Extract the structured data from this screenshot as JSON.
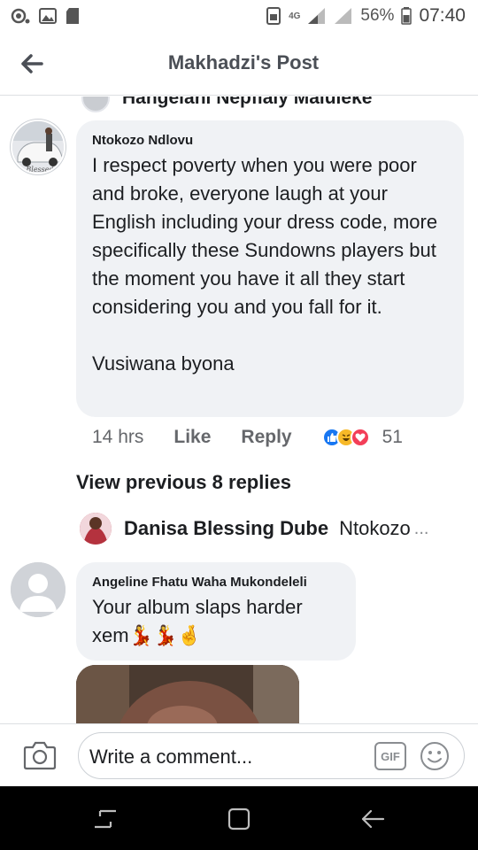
{
  "status_bar": {
    "battery_percent": "56%",
    "time": "07:40",
    "network": "4G",
    "icons": [
      "notification-icon",
      "gallery-icon",
      "sd-card-icon",
      "nfc-icon",
      "signal-icon",
      "battery-icon"
    ]
  },
  "header": {
    "title": "Makhadzi's Post",
    "back_icon": "arrow-left-icon"
  },
  "clipped_previous": {
    "text": "Hangelani Nepfialy Maluleke"
  },
  "comment": {
    "author": "Ntokozo Ndlovu",
    "body": "I respect poverty when you were poor and broke, everyone laugh at your English including your dress code, more specifically these Sundowns players but the moment you have it all they start considering you and you fall for it.",
    "body_2": "Vusiwana byona",
    "time": "14 hrs",
    "like_label": "Like",
    "reply_label": "Reply",
    "reaction_count": "51",
    "reactions": [
      "like-reaction-icon",
      "haha-reaction-icon",
      "love-reaction-icon"
    ]
  },
  "view_previous_label": "View previous 8 replies",
  "reply_preview": {
    "author": "Danisa Blessing Dube",
    "preview": "Ntokozo",
    "ellipsis": "..."
  },
  "comment_2": {
    "author": "Angeline Fhatu Waha Mukondeleli",
    "body_line1": "Your album slaps harder",
    "body_line2": "xem",
    "emojis": "💃💃🤞"
  },
  "composer": {
    "placeholder": "Write a comment...",
    "gif_label": "GIF"
  },
  "colors": {
    "bubble": "#f0f2f5",
    "like_blue": "#1877f2",
    "meta_gray": "#65676b"
  }
}
